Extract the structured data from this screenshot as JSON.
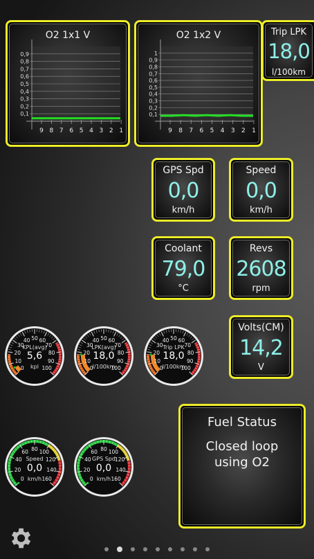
{
  "o2_chart_1": {
    "title": "O2 1x1 V",
    "y_ticks": [
      "0,9",
      "0,8",
      "0,7",
      "0,6",
      "0,5",
      "0,4",
      "0,3",
      "0,2",
      "0,1"
    ],
    "x_ticks": [
      "9",
      "8",
      "7",
      "6",
      "5",
      "4",
      "3",
      "2",
      "1"
    ]
  },
  "o2_chart_2": {
    "title": "O2 1x2 V",
    "y_ticks": [
      "1",
      "0,9",
      "0,8",
      "0,7",
      "0,6",
      "0,5",
      "0,4",
      "0,3",
      "0,2",
      "0,1"
    ],
    "x_ticks": [
      "9",
      "8",
      "7",
      "6",
      "5",
      "4",
      "3",
      "2",
      "1"
    ]
  },
  "trip_lpk": {
    "title": "Trip LPK",
    "value": "18,0",
    "unit": "l/100km"
  },
  "gps_speed": {
    "title": "GPS Spd",
    "value": "0,0",
    "unit": "km/h"
  },
  "speed": {
    "title": "Speed",
    "value": "0,0",
    "unit": "km/h"
  },
  "coolant": {
    "title": "Coolant",
    "value": "79,0",
    "unit": "°C"
  },
  "revs": {
    "title": "Revs",
    "value": "2608",
    "unit": "rpm"
  },
  "volts": {
    "title": "Volts(CM)",
    "value": "14,2",
    "unit": "V"
  },
  "fuel_status": {
    "title": "Fuel Status",
    "line1": "Closed loop",
    "line2": "using O2"
  },
  "gauges": {
    "kpl": {
      "label": "KPL(avg)",
      "value": "5,6",
      "unit": "kpl",
      "ticks": [
        "0",
        "10",
        "20",
        "30",
        "40",
        "50",
        "60",
        "70",
        "80",
        "90",
        "100"
      ]
    },
    "lpk": {
      "label": "LPK(avg)",
      "value": "18,0",
      "unit": "l/100km",
      "ticks": [
        "0",
        "10",
        "20",
        "30",
        "40",
        "50",
        "60",
        "70",
        "80",
        "90",
        "100"
      ]
    },
    "trip_lpk": {
      "label": "Trip LPK",
      "value": "18,0",
      "unit": "l/100km",
      "ticks": [
        "0",
        "10",
        "20",
        "30",
        "40",
        "50",
        "60",
        "70",
        "80",
        "90",
        "100"
      ]
    },
    "speed": {
      "label": "Speed",
      "value": "0,0",
      "unit": "km/h",
      "ticks": [
        "0",
        "20",
        "40",
        "60",
        "80",
        "100",
        "120",
        "140",
        "160"
      ]
    },
    "gps_speed": {
      "label": "GPS Spd",
      "value": "0,0",
      "unit": "km/h",
      "ticks": [
        "0",
        "20",
        "40",
        "60",
        "80",
        "100",
        "120",
        "140",
        "160"
      ]
    }
  },
  "o2_series_1": [
    0.04,
    0.04,
    0.04,
    0.04,
    0.04,
    0.04,
    0.04,
    0.04,
    0.04
  ],
  "o2_series_2": [
    0.08,
    0.08,
    0.09,
    0.08,
    0.09,
    0.08,
    0.09,
    0.08,
    0.08
  ],
  "colors": {
    "frame": "#ecec2a",
    "digit": "#8ef0e8",
    "line": "#22dd22"
  },
  "pager": {
    "count": 9,
    "active": 1
  }
}
